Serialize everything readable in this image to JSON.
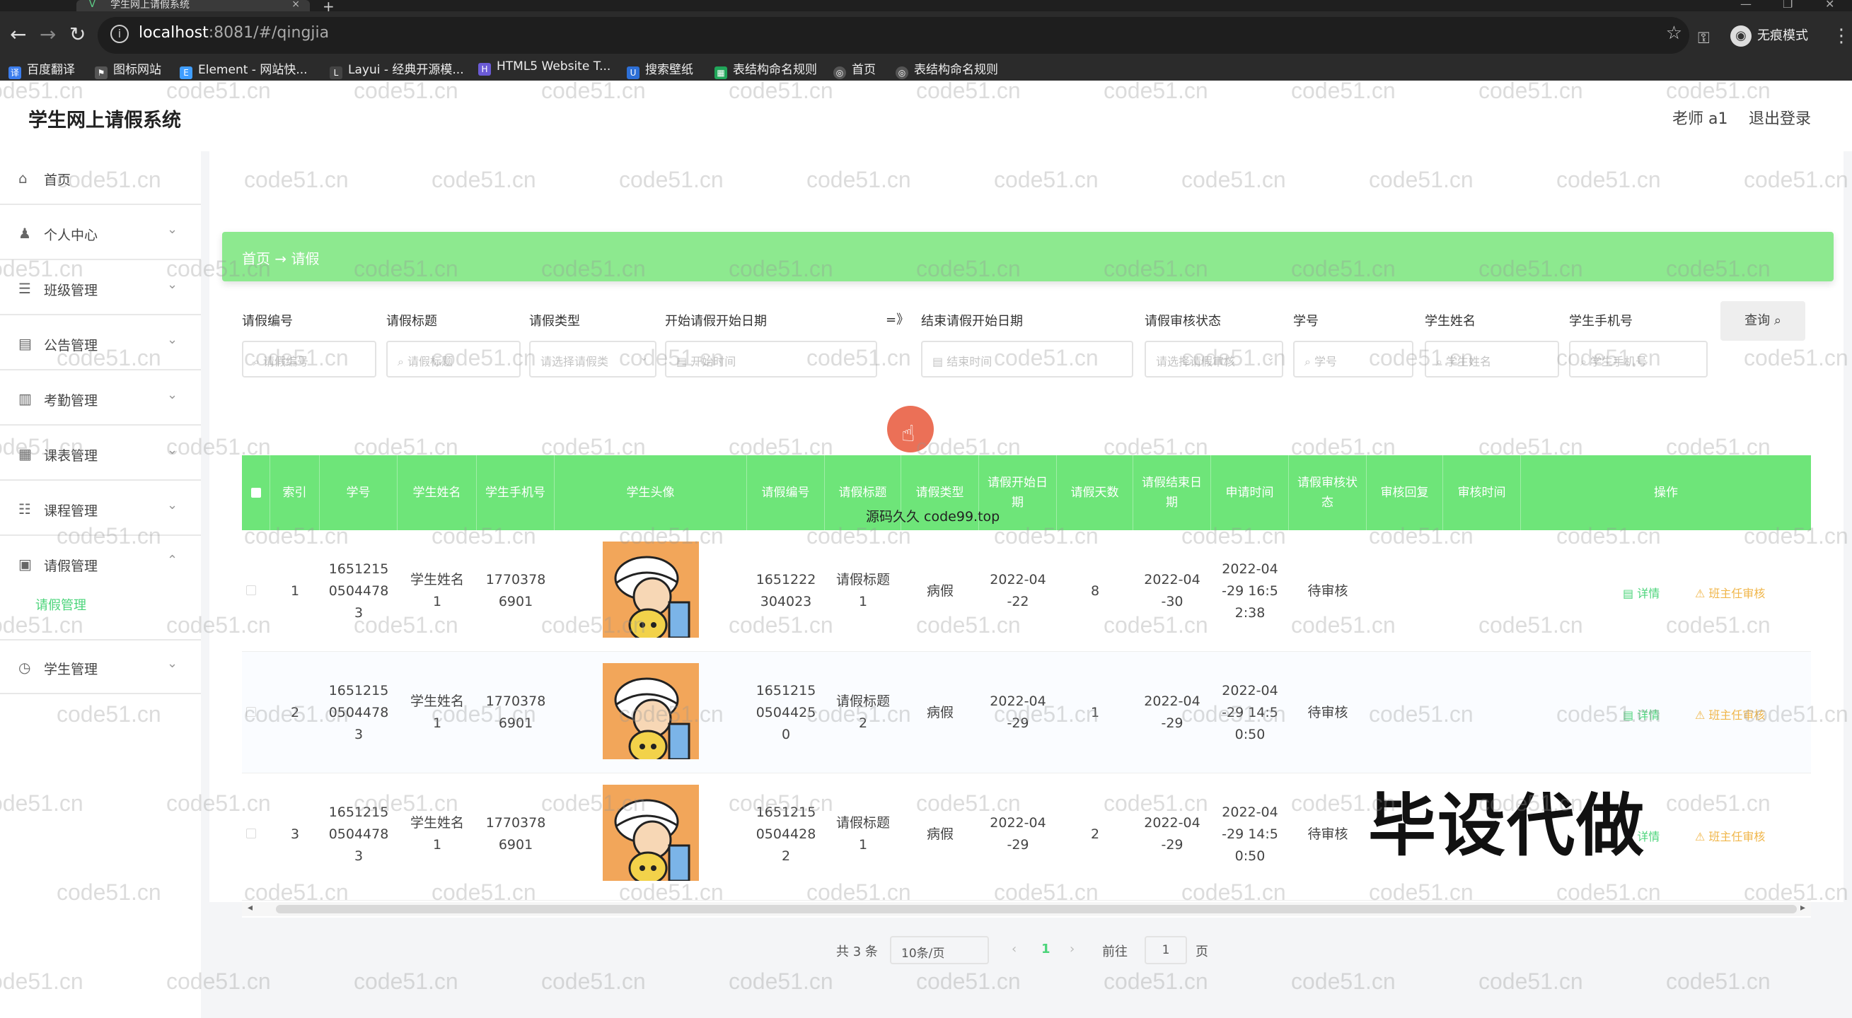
{
  "browser": {
    "tab_title": "学生网上请假系统",
    "tab_close": "×",
    "new_tab": "+",
    "url_host": "localhost",
    "url_rest": ":8081/#/qingjia",
    "incognito_label": "无痕模式",
    "nav_back": "←",
    "nav_forward": "→",
    "nav_reload": "↻",
    "star": "☆",
    "key": "⚿",
    "menu": "⋮",
    "bookmarks": [
      "百度翻译",
      "图标网站",
      "Element - 网站快...",
      "Layui - 经典开源模...",
      "HTML5 Website T...",
      "搜索壁纸",
      "表结构命名规则",
      "首页",
      "表结构命名规则"
    ]
  },
  "app": {
    "title": "学生网上请假系统",
    "user_name": "老师 a1",
    "logout": "退出登录"
  },
  "sidebar": {
    "items": [
      {
        "label": "首页",
        "icon": "⌂",
        "chevron": ""
      },
      {
        "label": "个人中心",
        "icon": "♟",
        "chevron": "⌄"
      },
      {
        "label": "班级管理",
        "icon": "☰",
        "chevron": "⌄"
      },
      {
        "label": "公告管理",
        "icon": "▤",
        "chevron": "⌄"
      },
      {
        "label": "考勤管理",
        "icon": "▥",
        "chevron": "⌄"
      },
      {
        "label": "课表管理",
        "icon": "▦",
        "chevron": "⌄"
      },
      {
        "label": "课程管理",
        "icon": "☷",
        "chevron": "⌄"
      },
      {
        "label": "请假管理",
        "icon": "▣",
        "chevron": "⌃"
      },
      {
        "label": "学生管理",
        "icon": "◷",
        "chevron": "⌄"
      }
    ],
    "sub_item": "请假管理"
  },
  "breadcrumb": "首页 → 请假",
  "search": {
    "arrow": "=》",
    "labels": [
      "请假编号",
      "请假标题",
      "请假类型",
      "开始请假开始日期",
      "结束请假开始日期",
      "请假审核状态",
      "学号",
      "学生姓名",
      "学生手机号"
    ],
    "placeholders": [
      "请假编号",
      "请假标题",
      "请选择请假类",
      "开始时间",
      "结束时间",
      "请选择请假审核",
      "学号",
      "学生姓名",
      "学生手机号"
    ],
    "button": "查询 ⌕"
  },
  "table": {
    "headers": [
      "",
      "索引",
      "学号",
      "学生姓名",
      "学生手机号",
      "学生头像",
      "请假编号",
      "请假标题",
      "请假类型",
      "请假开始日期",
      "请假天数",
      "请假结束日期",
      "申请时间",
      "请假审核状态",
      "审核回复",
      "审核时间",
      "操作"
    ],
    "rows": [
      {
        "index": "1",
        "student_no": "1651215\n0504478\n3",
        "name": "学生姓名\n1",
        "phone": "1770378\n6901",
        "leave_no": "1651222\n304023",
        "title": "请假标题\n1",
        "type": "病假",
        "start": "2022-04\n-22",
        "days": "8",
        "end": "2022-04\n-30",
        "apply_time": "2022-04\n-29 16:5\n2:38",
        "status": "待审核",
        "reply": "",
        "review_time": "",
        "act_detail": "▤ 详情",
        "act_review": "⚠ 班主任审核"
      },
      {
        "index": "2",
        "student_no": "1651215\n0504478\n3",
        "name": "学生姓名\n1",
        "phone": "1770378\n6901",
        "leave_no": "1651215\n0504425\n0",
        "title": "请假标题\n2",
        "type": "病假",
        "start": "2022-04\n-29",
        "days": "1",
        "end": "2022-04\n-29",
        "apply_time": "2022-04\n-29 14:5\n0:50",
        "status": "待审核",
        "reply": "",
        "review_time": "",
        "act_detail": "▤ 详情",
        "act_review": "⚠ 班主任审核"
      },
      {
        "index": "3",
        "student_no": "1651215\n0504478\n3",
        "name": "学生姓名\n1",
        "phone": "1770378\n6901",
        "leave_no": "1651215\n0504428\n2",
        "title": "请假标题\n1",
        "type": "病假",
        "start": "2022-04\n-29",
        "days": "2",
        "end": "2022-04\n-29",
        "apply_time": "2022-04\n-29 14:5\n0:50",
        "status": "待审核",
        "reply": "",
        "review_time": "",
        "act_detail": "▤ 详情",
        "act_review": "⚠ 班主任审核"
      }
    ]
  },
  "pagination": {
    "total": "共 3 条",
    "page_size": "10条/页",
    "prev": "‹",
    "current": "1",
    "next": "›",
    "goto_label": "前往",
    "goto_value": "1",
    "page_suffix": "页"
  },
  "watermark_text": "code51.cn",
  "promo_text": "毕设代做",
  "overlay_text": "源码久久 code99.top",
  "colors": {
    "accent": "#6ee579",
    "breadcrumb_bg": "#8de98f",
    "active": "#4bd47a",
    "review": "#f0b64a"
  }
}
